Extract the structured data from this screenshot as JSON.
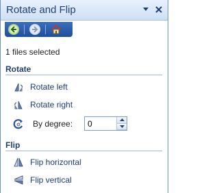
{
  "pane": {
    "title": "Rotate and Flip",
    "menu_icon": "dropdown-arrow-icon",
    "close_icon": "close-icon"
  },
  "toolbar": {
    "back_icon": "back-arrow-icon",
    "forward_icon": "forward-arrow-icon",
    "home_icon": "home-icon"
  },
  "status": {
    "text": "1 files selected"
  },
  "rotate": {
    "heading": "Rotate",
    "left_label": "Rotate left",
    "right_label": "Rotate right",
    "degree_label": "By degree:",
    "degree_value": "0"
  },
  "flip": {
    "heading": "Flip",
    "horizontal_label": "Flip horizontal",
    "vertical_label": "Flip vertical"
  },
  "colors": {
    "title_text": "#1e3f74",
    "link_text": "#1c3b74",
    "toolbar_bg": "#2b5fae",
    "section_rule": "#9db7dd"
  }
}
